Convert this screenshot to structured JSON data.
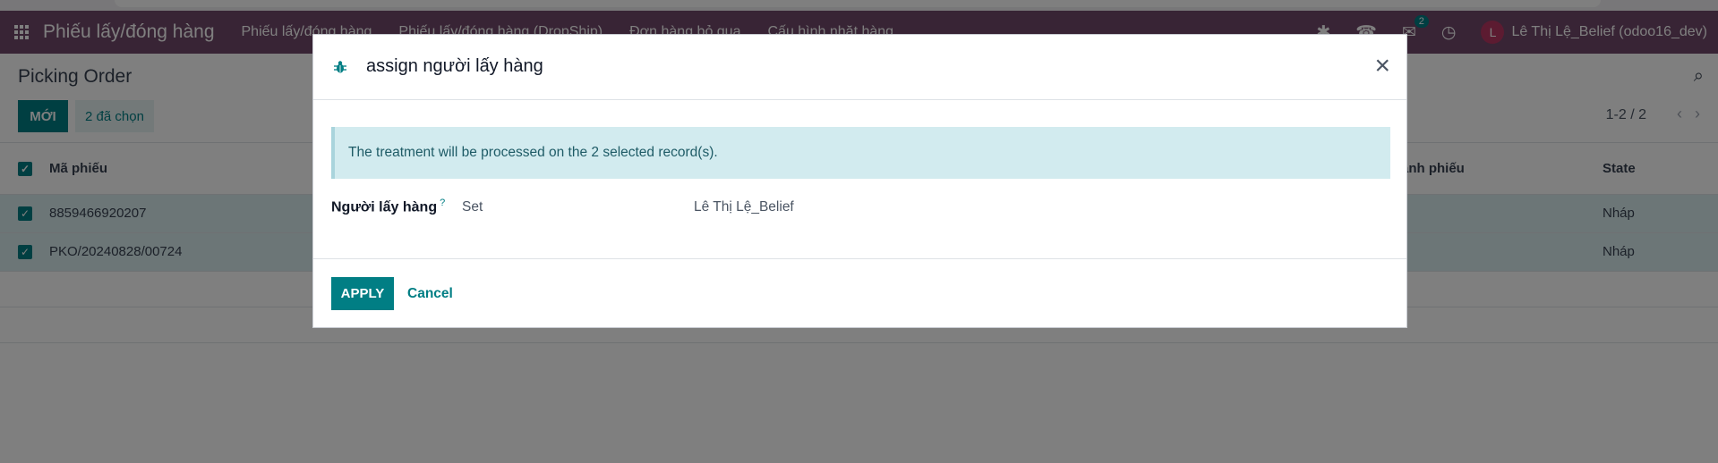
{
  "navbar": {
    "brand": "Phiếu lấy/đóng hàng",
    "menu": [
      "Phiếu lấy/đóng hàng",
      "Phiếu lấy/đóng hàng (DropShip)",
      "Đơn hàng bỏ qua",
      "Cấu hình nhặt hàng"
    ],
    "messages_count": "2",
    "user_initial": "L",
    "user_label": "Lê Thị Lệ_Belief (odoo16_dev)"
  },
  "control": {
    "title": "Picking Order",
    "new_label": "MỚI",
    "selected_label": "2 đã chọn",
    "pager": "1-2 / 2"
  },
  "list": {
    "columns": {
      "code": "Mã phiếu",
      "mid": "ành phiếu",
      "state": "State"
    },
    "rows": [
      {
        "code": "8859466920207",
        "state": "Nháp"
      },
      {
        "code": "PKO/20240828/00724",
        "state": "Nháp"
      }
    ]
  },
  "dialog": {
    "title": "assign người lấy hàng",
    "alert": "The treatment will be processed on the 2 selected record(s).",
    "field_label": "Người lấy hàng",
    "help_mark": "?",
    "operation": "Set",
    "value": "Lê Thị Lệ_Belief",
    "apply_label": "APPLY",
    "cancel_label": "Cancel"
  },
  "colors": {
    "primary": "#017e84",
    "navbar": "#71496a",
    "alert_bg": "#d2ebef"
  }
}
